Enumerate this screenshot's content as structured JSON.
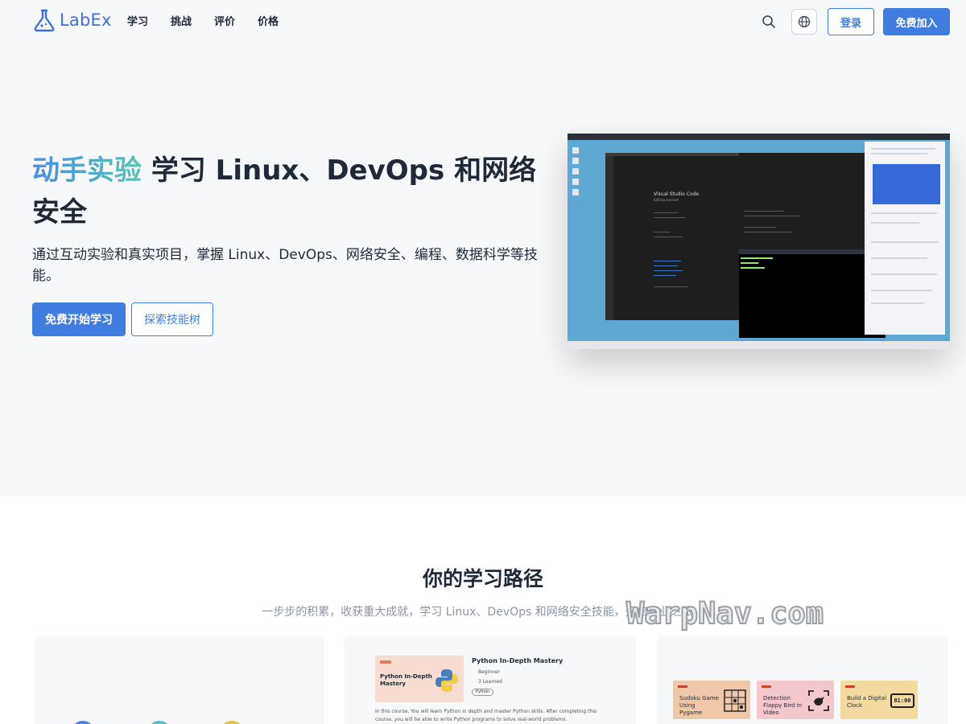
{
  "header": {
    "logo_text": "LabEx",
    "nav": [
      "学习",
      "挑战",
      "评价",
      "价格"
    ],
    "login_label": "登录",
    "join_label": "免费加入",
    "accent_color": "#3f7de0"
  },
  "hero": {
    "title_highlight": "动手实验",
    "title_rest": " 学习 Linux、DevOps 和网络安全",
    "subtitle": "通过互动实验和真实项目，掌握 Linux、DevOps、网络安全、编程、数据科学等技能。",
    "primary_button": "免费开始学习",
    "secondary_button": "探索技能树",
    "screenshot": {
      "vscode_title": "Visual Studio Code",
      "vscode_subtitle": "Editing evolved"
    }
  },
  "learning_path": {
    "title": "你的学习路径",
    "subtitle": "一步步的积累，收获重大成就，学习 Linux、DevOps 和网络安全技能，开启职业之旅。",
    "course": {
      "thumb_label": "Python In-Depth Mastery",
      "title": "Python In-Depth Mastery",
      "level": "Beginner",
      "learned": "3 Learned",
      "tag": "Python",
      "description": "In this course, You will learn Python in depth and master Python skills. After completing this course, you will be able to write Python programs to solve real-world problems."
    },
    "projects": [
      {
        "label": "Sudoku Game Using Pygame",
        "color": "#efc9a7"
      },
      {
        "label": "Detection Flappy Bird in Video",
        "color": "#f3c7cc"
      },
      {
        "label": "Build a Digital Clock",
        "color": "#f3dba0"
      }
    ],
    "clock_text": "01:00"
  },
  "watermark": "WarpNav.com"
}
